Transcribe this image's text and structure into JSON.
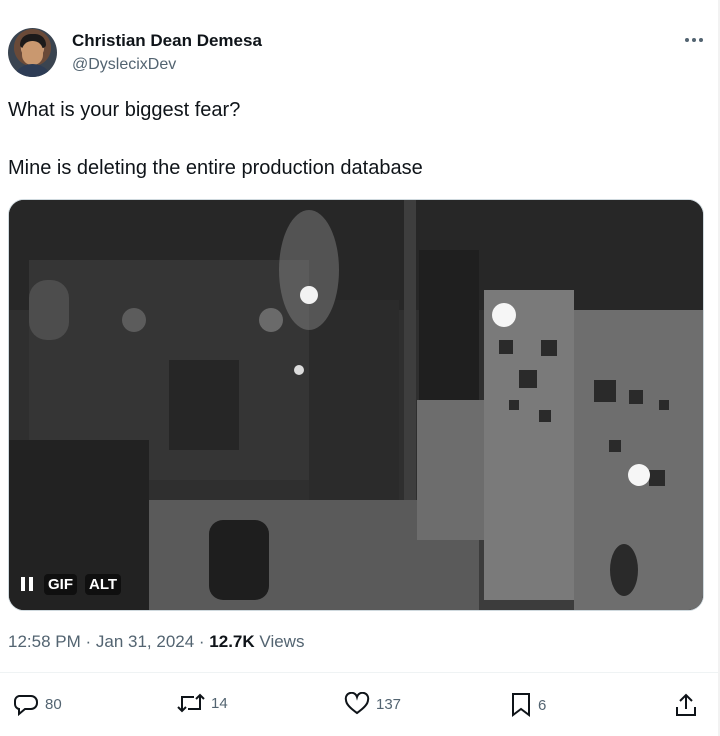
{
  "author": {
    "name": "Christian Dean Demesa",
    "handle": "@DyslecixDev"
  },
  "tweet": {
    "lines": [
      "What is your biggest fear?",
      "Mine is deleting the entire production database"
    ]
  },
  "media": {
    "gif_label": "GIF",
    "alt_label": "ALT"
  },
  "meta": {
    "time": "12:58 PM",
    "separator": " · ",
    "date": "Jan 31, 2024",
    "views_count": "12.7K",
    "views_label": "Views"
  },
  "actions": {
    "replies": "80",
    "reposts": "14",
    "likes": "137",
    "bookmarks": "6"
  },
  "icons": [
    "more-icon",
    "pause-icon",
    "reply-icon",
    "repost-icon",
    "like-icon",
    "bookmark-icon",
    "share-icon"
  ]
}
